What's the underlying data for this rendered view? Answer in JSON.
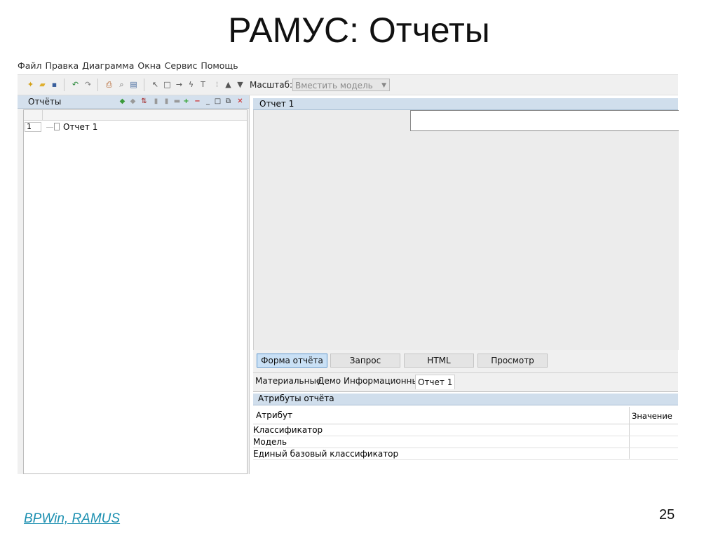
{
  "slide": {
    "title": "РАМУС: Отчеты",
    "footer_link": "BPWin, RAMUS",
    "page_number": "25"
  },
  "menu": [
    "Файл",
    "Правка",
    "Диаграмма",
    "Окна",
    "Сервис",
    "Помощь"
  ],
  "toolbar": {
    "scale_label": "Масштаб:",
    "scale_value": "Вместить модель"
  },
  "reports_panel": {
    "title": "Отчёты",
    "rows": [
      {
        "num": "1",
        "label": "Отчет 1"
      }
    ]
  },
  "report_editor": {
    "title": "Отчет 1",
    "view_buttons": [
      "Форма отчёта",
      "Запрос",
      "HTML",
      "Просмотр"
    ],
    "active_view": "Форма отчёта",
    "doc_tabs": [
      "Материальные",
      "Демо",
      "Информационные",
      "Отчет 1"
    ],
    "active_doc_tab": "Отчет 1"
  },
  "attributes": {
    "title": "Атрибуты отчёта",
    "columns": [
      "Атрибут",
      "Значение"
    ],
    "rows": [
      {
        "name": "Классификатор",
        "value": ""
      },
      {
        "name": "Модель",
        "value": ""
      },
      {
        "name": "Единый базовый классификатор",
        "value": ""
      }
    ]
  },
  "colors": {
    "panel_header": "#d4e0ed",
    "active_button": "#c9e0f5",
    "footer_link": "#1b8fb0"
  }
}
